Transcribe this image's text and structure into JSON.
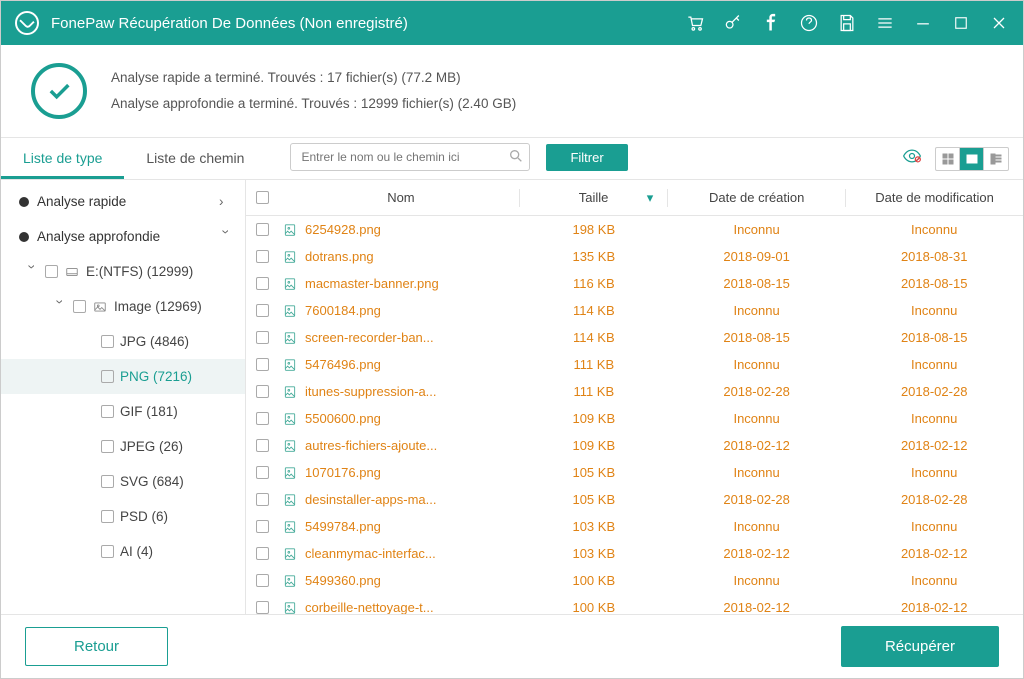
{
  "title": "FonePaw Récupération De Données (Non enregistré)",
  "status": {
    "line1": "Analyse rapide a terminé. Trouvés : 17 fichier(s) (77.2 MB)",
    "line2": "Analyse approfondie a terminé. Trouvés : 12999 fichier(s) (2.40 GB)"
  },
  "tabs": {
    "type": "Liste de type",
    "path": "Liste de chemin"
  },
  "search_placeholder": "Entrer le nom ou le chemin ici",
  "filter_label": "Filtrer",
  "columns": {
    "name": "Nom",
    "size": "Taille",
    "created": "Date de création",
    "modified": "Date de modification"
  },
  "sidebar": {
    "quick": "Analyse rapide",
    "deep": "Analyse approfondie",
    "drive": "E:(NTFS) (12999)",
    "image": "Image (12969)",
    "formats": [
      {
        "label": "JPG (4846)"
      },
      {
        "label": "PNG (7216)"
      },
      {
        "label": "GIF (181)"
      },
      {
        "label": "JPEG (26)"
      },
      {
        "label": "SVG (684)"
      },
      {
        "label": "PSD (6)"
      },
      {
        "label": "AI (4)"
      }
    ]
  },
  "files": [
    {
      "name": "6254928.png",
      "size": "198 KB",
      "created": "Inconnu",
      "modified": "Inconnu"
    },
    {
      "name": "dotrans.png",
      "size": "135 KB",
      "created": "2018-09-01",
      "modified": "2018-08-31"
    },
    {
      "name": "macmaster-banner.png",
      "size": "116 KB",
      "created": "2018-08-15",
      "modified": "2018-08-15"
    },
    {
      "name": "7600184.png",
      "size": "114 KB",
      "created": "Inconnu",
      "modified": "Inconnu"
    },
    {
      "name": "screen-recorder-ban...",
      "size": "114 KB",
      "created": "2018-08-15",
      "modified": "2018-08-15"
    },
    {
      "name": "5476496.png",
      "size": "111 KB",
      "created": "Inconnu",
      "modified": "Inconnu"
    },
    {
      "name": "itunes-suppression-a...",
      "size": "111 KB",
      "created": "2018-02-28",
      "modified": "2018-02-28"
    },
    {
      "name": "5500600.png",
      "size": "109 KB",
      "created": "Inconnu",
      "modified": "Inconnu"
    },
    {
      "name": "autres-fichiers-ajoute...",
      "size": "109 KB",
      "created": "2018-02-12",
      "modified": "2018-02-12"
    },
    {
      "name": "1070176.png",
      "size": "105 KB",
      "created": "Inconnu",
      "modified": "Inconnu"
    },
    {
      "name": "desinstaller-apps-ma...",
      "size": "105 KB",
      "created": "2018-02-28",
      "modified": "2018-02-28"
    },
    {
      "name": "5499784.png",
      "size": "103 KB",
      "created": "Inconnu",
      "modified": "Inconnu"
    },
    {
      "name": "cleanmymac-interfac...",
      "size": "103 KB",
      "created": "2018-02-12",
      "modified": "2018-02-12"
    },
    {
      "name": "5499360.png",
      "size": "100 KB",
      "created": "Inconnu",
      "modified": "Inconnu"
    },
    {
      "name": "corbeille-nettoyage-t...",
      "size": "100 KB",
      "created": "2018-02-12",
      "modified": "2018-02-12"
    }
  ],
  "buttons": {
    "back": "Retour",
    "recover": "Récupérer"
  }
}
